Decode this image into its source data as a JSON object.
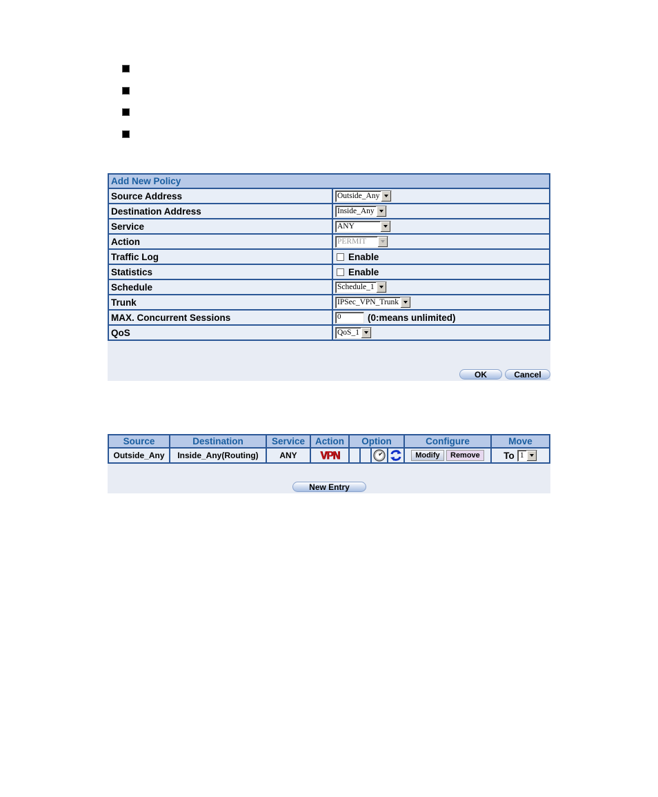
{
  "bullets": 4,
  "policy_form": {
    "title": "Add New Policy",
    "rows": [
      {
        "label": "Source Address",
        "type": "select",
        "value": "Outside_Any"
      },
      {
        "label": "Destination Address",
        "type": "select",
        "value": "Inside_Any"
      },
      {
        "label": "Service",
        "type": "select",
        "value": "ANY"
      },
      {
        "label": "Action",
        "type": "select-disabled",
        "value": "PERMIT"
      },
      {
        "label": "Traffic Log",
        "type": "checkbox",
        "value": "Enable",
        "checked": false
      },
      {
        "label": "Statistics",
        "type": "checkbox",
        "value": "Enable",
        "checked": false
      },
      {
        "label": "Schedule",
        "type": "select",
        "value": "Schedule_1"
      },
      {
        "label": "Trunk",
        "type": "select",
        "value": "IPSec_VPN_Trunk"
      },
      {
        "label": "MAX. Concurrent Sessions",
        "type": "text",
        "value": "0",
        "note": "(0:means unlimited)"
      },
      {
        "label": "QoS",
        "type": "select",
        "value": "QoS_1"
      }
    ],
    "ok_label": "OK",
    "cancel_label": "Cancel"
  },
  "policy_list": {
    "headers": [
      "Source",
      "Destination",
      "Service",
      "Action",
      "Option",
      "Configure",
      "Move"
    ],
    "rows": [
      {
        "source": "Outside_Any",
        "destination": "Inside_Any(Routing)",
        "service": "ANY",
        "action": "VPN",
        "options": [
          "",
          "",
          "clock-icon",
          "sync-icon"
        ],
        "modify_label": "Modify",
        "remove_label": "Remove",
        "move_label": "To",
        "move_value": "1"
      }
    ],
    "new_entry_label": "New Entry"
  },
  "colors": {
    "border": "#2b5796",
    "header_bg": "#b7c9e8",
    "header_text": "#1a5ea0",
    "row_bg": "#e8eef7",
    "vpn_red": "#c0161b"
  }
}
